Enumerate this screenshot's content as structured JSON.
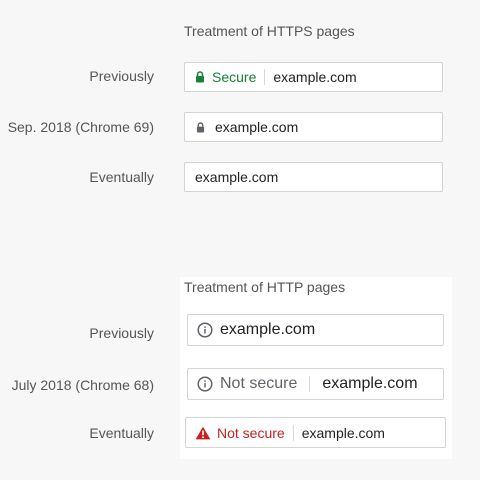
{
  "https_section": {
    "heading": "Treatment of HTTPS pages",
    "rows": [
      {
        "label": "Previously",
        "badge": "Secure",
        "url": "example.com",
        "icon": "lock-icon-green"
      },
      {
        "label": "Sep. 2018 (Chrome 69)",
        "url": "example.com",
        "icon": "lock-icon-grey"
      },
      {
        "label": "Eventually",
        "url": "example.com"
      }
    ]
  },
  "http_section": {
    "heading": "Treatment of HTTP pages",
    "rows": [
      {
        "label": "Previously",
        "url": "example.com",
        "icon": "info-icon"
      },
      {
        "label": "July 2018 (Chrome 68)",
        "badge": "Not secure",
        "url": "example.com",
        "icon": "info-icon"
      },
      {
        "label": "Eventually",
        "badge": "Not secure",
        "url": "example.com",
        "icon": "warning-icon"
      }
    ]
  },
  "colors": {
    "secure": "#188038",
    "not_secure_red": "#c5221f",
    "grey": "#5f6368"
  }
}
